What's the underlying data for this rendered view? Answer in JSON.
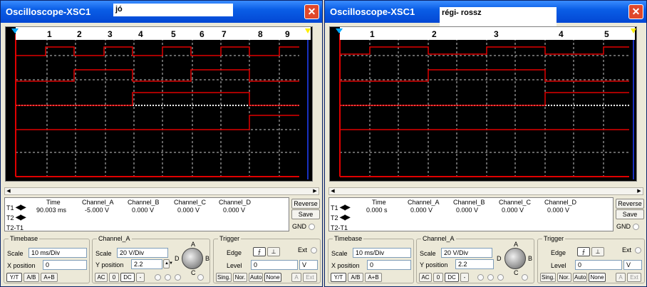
{
  "windows": [
    {
      "title": "Oscilloscope-XSC1",
      "note": "jó",
      "close_glyph": "✕",
      "markers": [
        "1",
        "2",
        "3",
        "4",
        "5",
        "6",
        "7",
        "8",
        "9"
      ],
      "readout": {
        "t1": "T1",
        "t2": "T2",
        "t2t1": "T2-T1",
        "headers": [
          "Time",
          "Channel_A",
          "Channel_B",
          "Channel_C",
          "Channel_D"
        ],
        "values": [
          "90.003 ms",
          "-5.000 V",
          "0.000 V",
          "0.000 V",
          "0.000 V"
        ]
      },
      "buttons": {
        "reverse": "Reverse",
        "save": "Save",
        "gnd": "GND"
      },
      "timebase": {
        "title": "Timebase",
        "scale_label": "Scale",
        "scale": "10 ms/Div",
        "xpos_label": "X position",
        "xpos": "0",
        "modes": [
          "Y/T",
          "A/B",
          "A+B"
        ]
      },
      "channel": {
        "title": "Channel_A",
        "scale_label": "Scale",
        "scale": "20  V/Div",
        "ypos_label": "Y position",
        "ypos": "2.2",
        "modes": [
          "AC",
          "0",
          "DC",
          "-"
        ],
        "knob_labels": [
          "A",
          "B",
          "C",
          "D"
        ]
      },
      "trigger": {
        "title": "Trigger",
        "edge_label": "Edge",
        "level_label": "Level",
        "level": "0",
        "level_unit": "V",
        "ext": "Ext",
        "modes": [
          "Sing.",
          "Nor.",
          "Auto",
          "None"
        ],
        "src": [
          "A",
          "Ext"
        ]
      }
    },
    {
      "title": "Oscilloscope-XSC1",
      "note": "régi- rossz",
      "close_glyph": "✕",
      "markers": [
        "1",
        "2",
        "3",
        "4",
        "5"
      ],
      "readout": {
        "t1": "T1",
        "t2": "T2",
        "t2t1": "T2-T1",
        "headers": [
          "Time",
          "Channel_A",
          "Channel_B",
          "Channel_C",
          "Channel_D"
        ],
        "values": [
          "0.000 s",
          "0.000 V",
          "0.000 V",
          "0.000 V",
          "0.000 V"
        ]
      },
      "buttons": {
        "reverse": "Reverse",
        "save": "Save",
        "gnd": "GND"
      },
      "timebase": {
        "title": "Timebase",
        "scale_label": "Scale",
        "scale": "10 ms/Div",
        "xpos_label": "X position",
        "xpos": "0",
        "modes": [
          "Y/T",
          "A/B",
          "A+B"
        ]
      },
      "channel": {
        "title": "Channel_A",
        "scale_label": "Scale",
        "scale": "20  V/Div",
        "ypos_label": "Y position",
        "ypos": "2.2",
        "modes": [
          "AC",
          "0",
          "DC",
          "-"
        ],
        "knob_labels": [
          "A",
          "B",
          "C",
          "D"
        ]
      },
      "trigger": {
        "title": "Trigger",
        "edge_label": "Edge",
        "level_label": "Level",
        "level": "0",
        "level_unit": "V",
        "ext": "Ext",
        "modes": [
          "Sing.",
          "Nor.",
          "Auto",
          "None"
        ],
        "src": [
          "A",
          "Ext"
        ]
      }
    }
  ],
  "colors": {
    "trace_red": "#e00000",
    "trace_white": "#ffffff",
    "grid": "#c8c8c8",
    "screen": "#000000",
    "cursor_blue": "#2040ff"
  }
}
